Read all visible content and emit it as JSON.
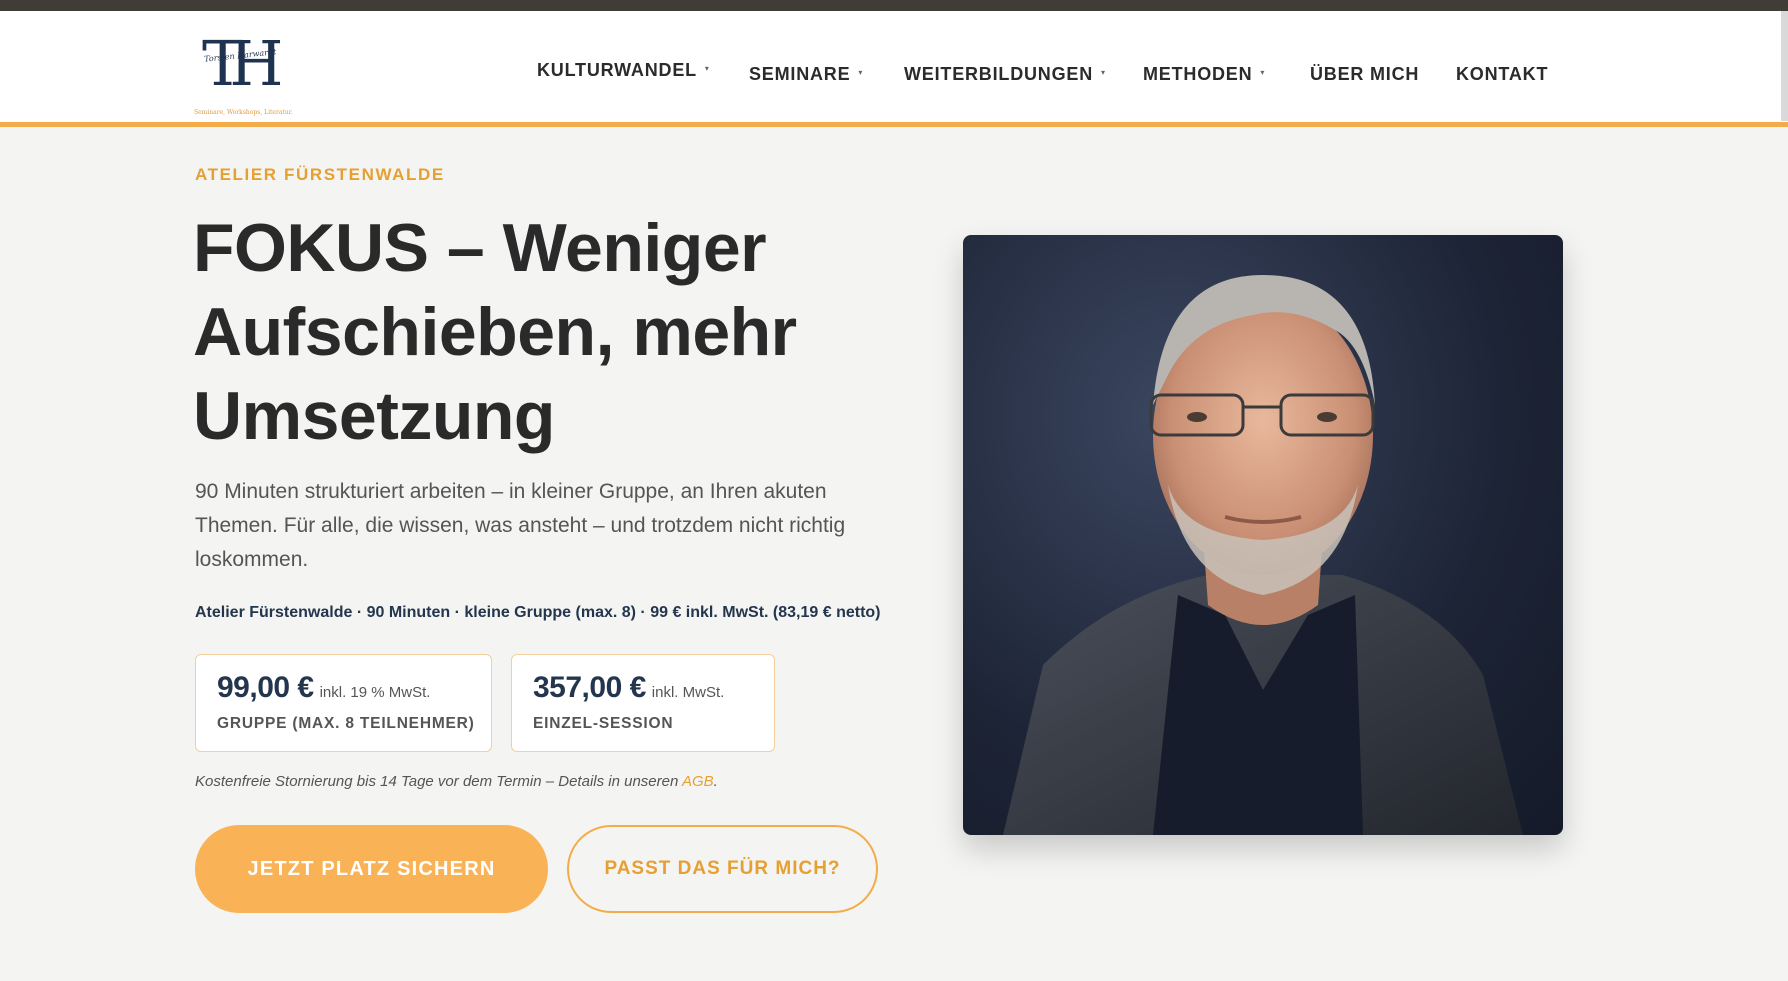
{
  "header": {
    "logo": {
      "letters": "TH",
      "script": "Torsten Harwardt",
      "tagline": "Seminare, Workshops, Literatur."
    },
    "nav": [
      {
        "label": "KULTURWANDEL",
        "has_dropdown": true
      },
      {
        "label": "SEMINARE",
        "has_dropdown": true
      },
      {
        "label": "WEITERBILDUNGEN",
        "has_dropdown": true
      },
      {
        "label": "METHODEN",
        "has_dropdown": true
      },
      {
        "label": "ÜBER MICH",
        "has_dropdown": false
      },
      {
        "label": "KONTAKT",
        "has_dropdown": false
      }
    ],
    "caret": "▾"
  },
  "hero": {
    "eyebrow": "ATELIER FÜRSTENWALDE",
    "title": "FOKUS – Weniger Aufschieben, mehr Umsetzung",
    "lead": "90 Minuten strukturiert arbeiten – in kleiner Gruppe, an Ihren akuten Themen. Für alle, die wissen, was ansteht – und trotzdem nicht richtig loskommen.",
    "facts": "Atelier Fürstenwalde · 90 Minuten · kleine Gruppe (max. 8) · 99 € inkl. MwSt. (83,19 € netto)",
    "prices": [
      {
        "amount": "99,00 €",
        "vat": "inkl. 19 % MwSt.",
        "label": "GRUPPE (MAX. 8 TEILNEHMER)"
      },
      {
        "amount": "357,00 €",
        "vat": "inkl. MwSt.",
        "label": "EINZEL-SESSION"
      }
    ],
    "note_text": "Kostenfreie Stornierung bis 14 Tage vor dem Termin – Details in unseren ",
    "note_link": "AGB",
    "note_end": ".",
    "primary_button": "JETZT PLATZ SICHERN",
    "secondary_button": "PASST DAS FÜR MICH?"
  },
  "colors": {
    "accent": "#f4ac4a",
    "navy": "#24364e",
    "background": "#f4f4f2"
  }
}
